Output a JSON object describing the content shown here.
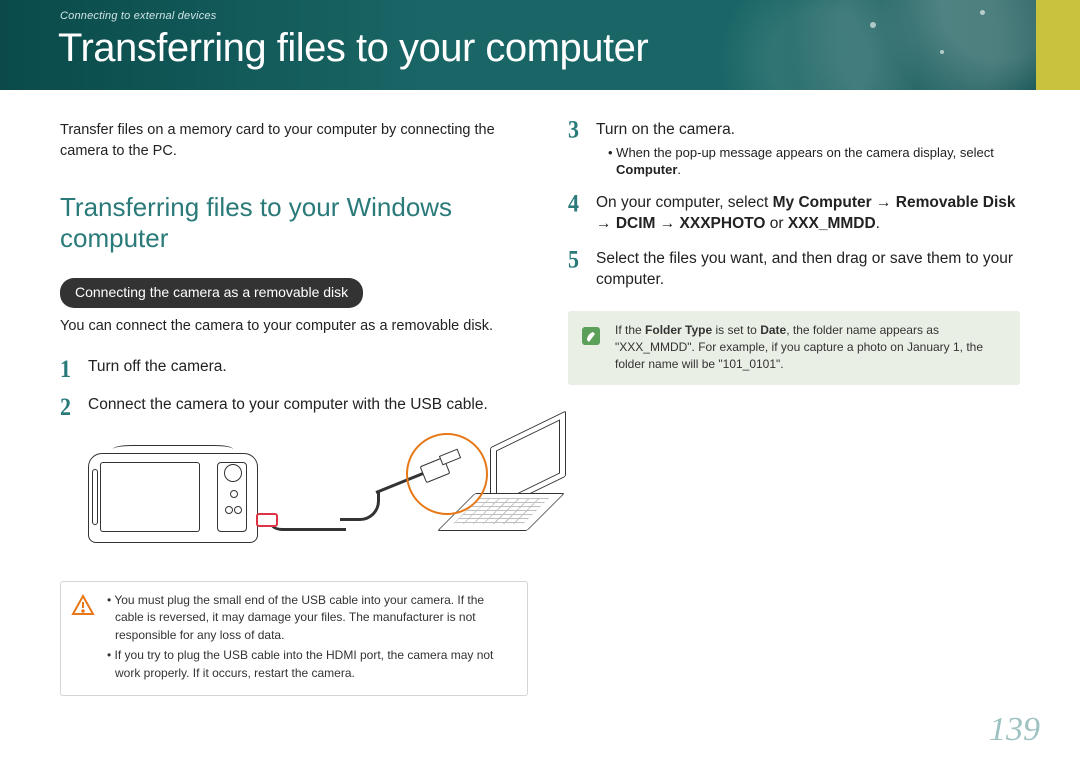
{
  "header": {
    "breadcrumb": "Connecting to external devices",
    "title": "Transferring files to your computer"
  },
  "left": {
    "intro": "Transfer files on a memory card to your computer by connecting the camera to the PC.",
    "section_title": "Transferring files to your Windows computer",
    "pill": "Connecting the camera as a removable disk",
    "subtext": "You can connect the camera to your computer as a removable disk.",
    "step1_num": "1",
    "step1": "Turn off the camera.",
    "step2_num": "2",
    "step2": "Connect the camera to your computer with the USB cable.",
    "warning_li1": "You must plug the small end of the USB cable into your camera. If the cable is reversed, it may damage your files. The manufacturer is not responsible for any loss of data.",
    "warning_li2": "If you try to plug the USB cable into the HDMI port, the camera may not work properly. If it occurs, restart the camera."
  },
  "right": {
    "step3_num": "3",
    "step3_text": "Turn on the camera.",
    "step3_sub_a": "When the pop-up message appears on the camera display, select ",
    "step3_sub_b": "Computer",
    "step3_sub_c": ".",
    "step4_num": "4",
    "step4_a": "On your computer, select ",
    "step4_b": "My Computer",
    "step4_c": " → ",
    "step4_d": "Removable Disk",
    "step4_e": " → ",
    "step4_f": "DCIM",
    "step4_g": " → ",
    "step4_h": "XXXPHOTO",
    "step4_i": " or ",
    "step4_j": "XXX_MMDD",
    "step4_k": ".",
    "step5_num": "5",
    "step5": "Select the files you want, and then drag or save them to your computer.",
    "note_a": "If the ",
    "note_b": "Folder Type",
    "note_c": " is set to ",
    "note_d": "Date",
    "note_e": ", the folder name appears as \"XXX_MMDD\". For example, if you capture a photo on January 1, the folder name will be \"101_0101\"."
  },
  "page_number": "139"
}
